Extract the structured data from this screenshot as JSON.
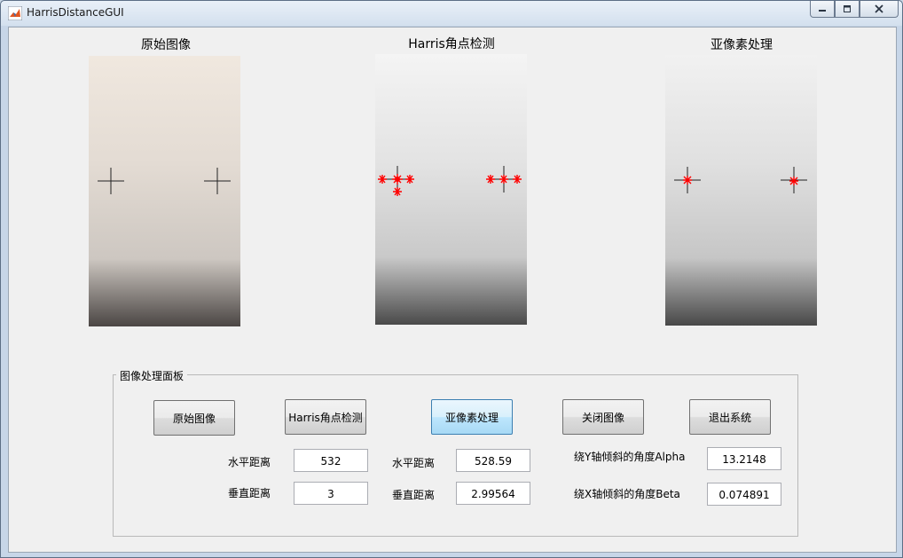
{
  "window": {
    "title": "HarrisDistanceGUI",
    "icons": [
      "matlab-icon",
      "minimize-icon",
      "restore-icon",
      "close-icon"
    ]
  },
  "axes": {
    "original_title": "原始图像",
    "harris_title": "Harris角点检测",
    "subpixel_title": "亚像素处理"
  },
  "panel": {
    "title": "图像处理面板",
    "buttons": {
      "original": "原始图像",
      "harris": "Harris角点检测",
      "subpixel": "亚像素处理",
      "close_image": "关闭图像",
      "exit": "退出系统"
    },
    "harris_h_label": "水平距离",
    "harris_h_value": "532",
    "harris_v_label": "垂直距离",
    "harris_v_value": "3",
    "sub_h_label": "水平距离",
    "sub_h_value": "528.59",
    "sub_v_label": "垂直距离",
    "sub_v_value": "2.99564",
    "alpha_label": "绕Y轴倾斜的角度Alpha",
    "alpha_value": "13.2148",
    "beta_label": "绕X轴倾斜的角度Beta",
    "beta_value": "0.074891"
  },
  "colors": {
    "marker": "#ff0000",
    "accent": "#3c7fb1"
  }
}
